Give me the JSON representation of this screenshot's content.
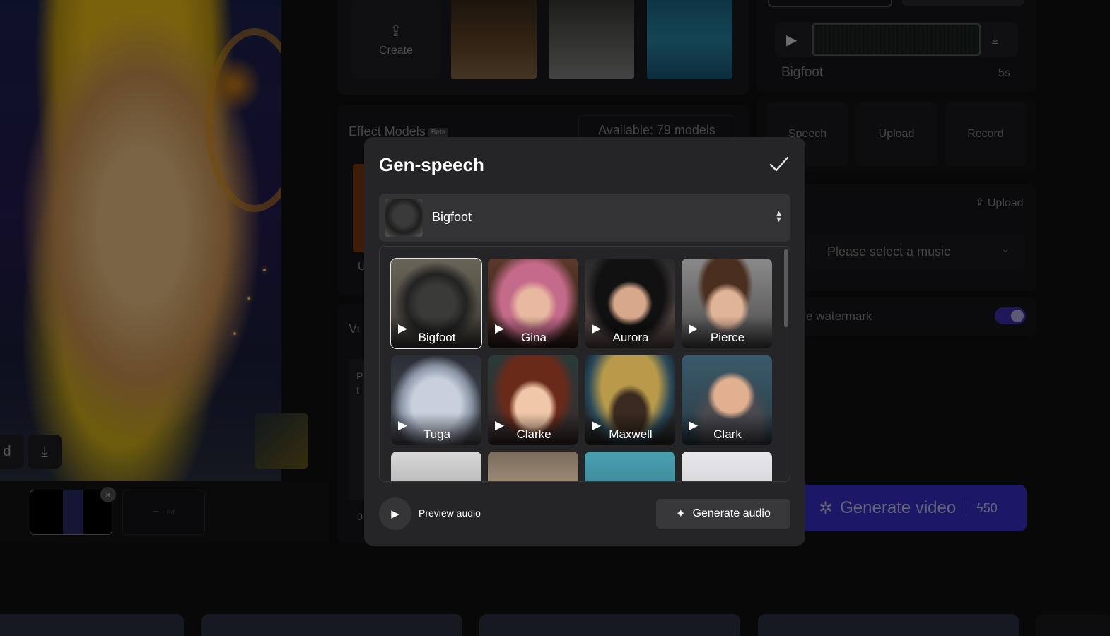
{
  "background": {
    "create_label": "Create",
    "effects_title": "Effect Models",
    "effects_badge": "Beta",
    "available_models": "Available: 79 models",
    "effects_cut_letter": "U",
    "video_section_title": "Vi",
    "video_text_line1": "P",
    "video_text_line2": "t",
    "video_bottom_text": "0",
    "frame_end_label": "End",
    "preview_cut_text": "d",
    "right_voice_name": "Bigfoot",
    "right_duration": "5s",
    "tabs": [
      "Speech",
      "Upload",
      "Record"
    ],
    "music_upload_label": "Upload",
    "music_placeholder": "Please select a music",
    "watermark_label": "e watermark",
    "generate_video_label": "Generate video",
    "generate_video_credits": "50",
    "accent_color": "#3a2fd0"
  },
  "modal": {
    "title": "Gen-speech",
    "selected_voice": "Bigfoot",
    "voices": [
      {
        "name": "Bigfoot",
        "selected": true
      },
      {
        "name": "Gina",
        "selected": false
      },
      {
        "name": "Aurora",
        "selected": false
      },
      {
        "name": "Pierce",
        "selected": false
      },
      {
        "name": "Tuga",
        "selected": false
      },
      {
        "name": "Clarke",
        "selected": false
      },
      {
        "name": "Maxwell",
        "selected": false
      },
      {
        "name": "Clark",
        "selected": false
      }
    ],
    "preview_audio_label": "Preview audio",
    "generate_audio_label": "Generate audio"
  }
}
